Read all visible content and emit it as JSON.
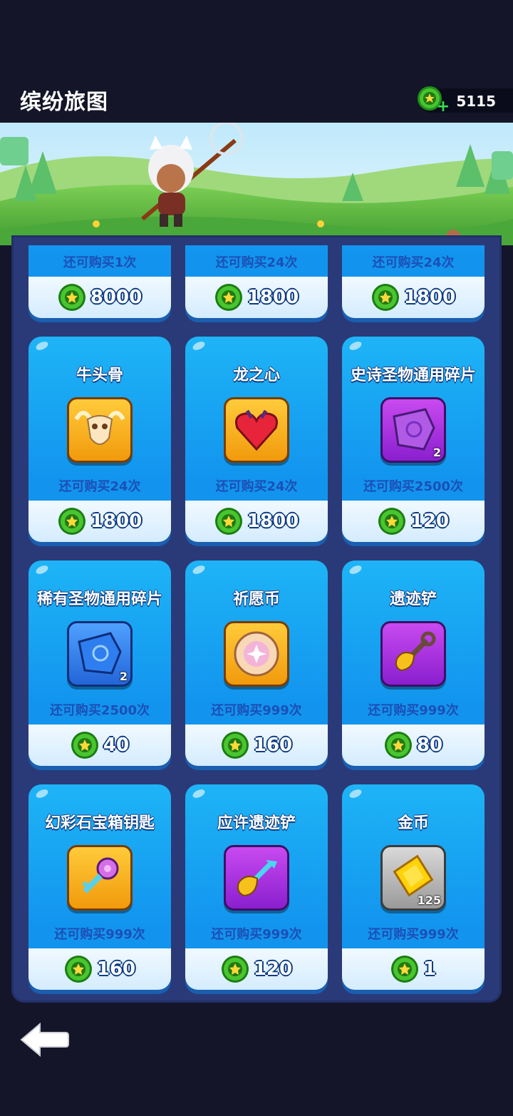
{
  "header": {
    "title": "缤纷旅图",
    "currency_amount": "5115"
  },
  "prev_row": [
    {
      "limit": "还可购买1次",
      "price": "8000"
    },
    {
      "limit": "还可购买24次",
      "price": "1800"
    },
    {
      "limit": "还可购买24次",
      "price": "1800"
    }
  ],
  "items": [
    {
      "name": "牛头骨",
      "icon": "bull-skull-icon",
      "limit": "还可购买24次",
      "price": "1800"
    },
    {
      "name": "龙之心",
      "icon": "dragon-heart-icon",
      "limit": "还可购买24次",
      "price": "1800"
    },
    {
      "name": "史诗圣物通用碎片",
      "icon": "epic-relic-shard-icon",
      "count": "2",
      "limit": "还可购买2500次",
      "price": "120"
    },
    {
      "name": "稀有圣物通用碎片",
      "icon": "rare-relic-shard-icon",
      "count": "2",
      "limit": "还可购买2500次",
      "price": "40"
    },
    {
      "name": "祈愿币",
      "icon": "wish-coin-icon",
      "limit": "还可购买999次",
      "price": "160"
    },
    {
      "name": "遗迹铲",
      "icon": "relic-shovel-icon",
      "limit": "还可购买999次",
      "price": "80"
    },
    {
      "name": "幻彩石宝箱钥匙",
      "icon": "chest-key-icon",
      "limit": "还可购买999次",
      "price": "160"
    },
    {
      "name": "应许遗迹铲",
      "icon": "promised-shovel-icon",
      "limit": "还可购买999次",
      "price": "120"
    },
    {
      "name": "金币",
      "icon": "gold-coin-icon",
      "count": "125",
      "limit": "还可购买999次",
      "price": "1"
    }
  ],
  "colors": {
    "card": "#1294ee",
    "price_coin": "#2fb31f",
    "background": "#141528"
  }
}
